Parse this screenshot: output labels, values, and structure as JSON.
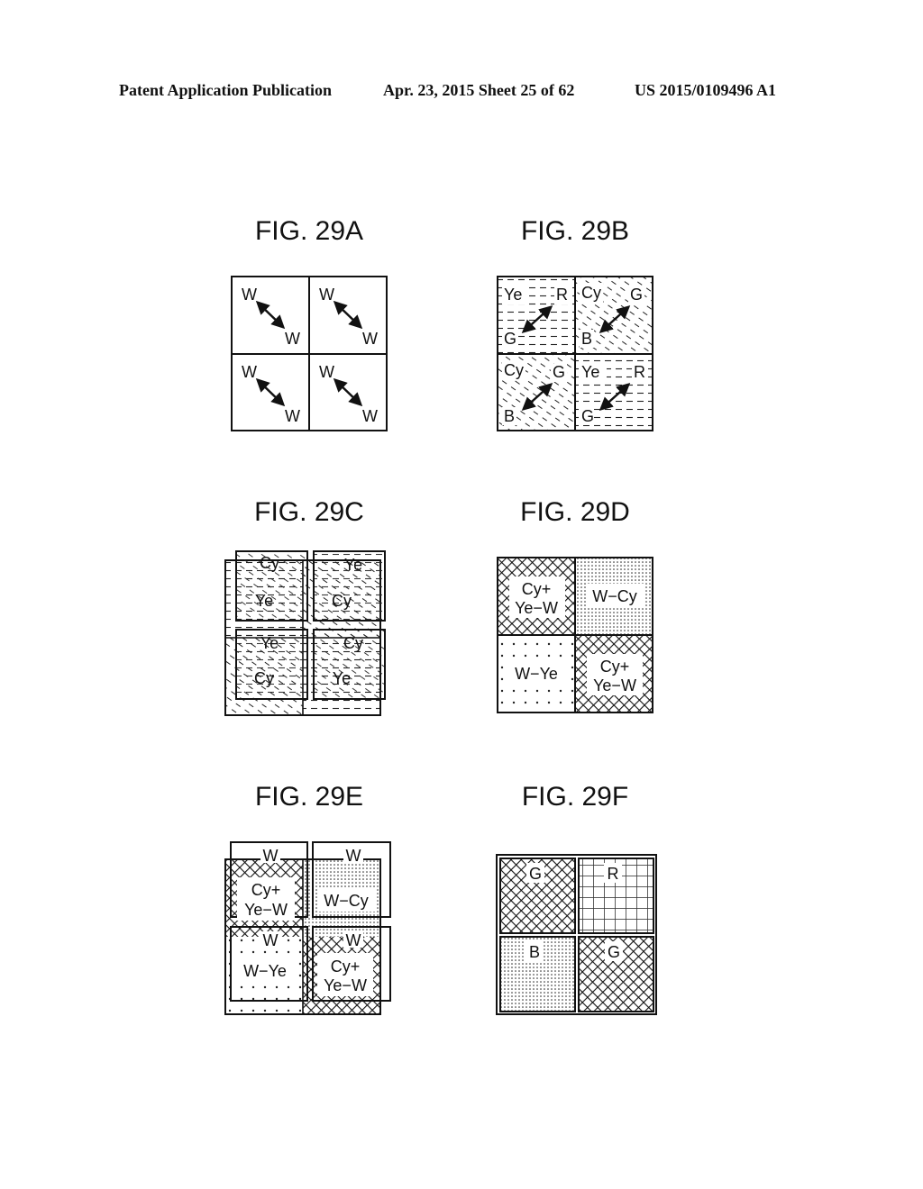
{
  "header": {
    "publication": "Patent Application Publication",
    "date_sheet": "Apr. 23, 2015  Sheet 25 of 62",
    "number": "US 2015/0109496 A1"
  },
  "figures": {
    "fig29a": {
      "title": "FIG. 29A",
      "cells": [
        {
          "top_left": "W",
          "bottom_right": "W"
        },
        {
          "top_left": "W",
          "bottom_right": "W"
        },
        {
          "top_left": "W",
          "bottom_right": "W"
        },
        {
          "top_left": "W",
          "bottom_right": "W"
        }
      ]
    },
    "fig29b": {
      "title": "FIG. 29B",
      "cells": [
        {
          "tl": "Ye",
          "tr": "R",
          "bl": "G",
          "pattern": "dashed-horizontal"
        },
        {
          "tl": "Cy",
          "tr": "G",
          "bl": "B",
          "pattern": "diagonal-dashed"
        },
        {
          "tl": "Cy",
          "tr": "G",
          "bl": "B",
          "pattern": "diagonal-dashed"
        },
        {
          "tl": "Ye",
          "tr": "R",
          "bl": "G",
          "pattern": "dashed-horizontal"
        }
      ]
    },
    "fig29c": {
      "title": "FIG. 29C",
      "cells": [
        {
          "top": "Cy",
          "center": "Ye"
        },
        {
          "top": "Ye",
          "center": "Cy"
        },
        {
          "top": "Ye",
          "center": "Cy"
        },
        {
          "top": "Cy",
          "center": "Ye"
        }
      ]
    },
    "fig29d": {
      "title": "FIG. 29D",
      "cells": [
        {
          "line1": "Cy+",
          "line2": "Ye−W",
          "pattern": "crosshatch"
        },
        {
          "line1": "W−Cy",
          "line2": "",
          "pattern": "fine-dots"
        },
        {
          "line1": "W−Ye",
          "line2": "",
          "pattern": "sparse-dots"
        },
        {
          "line1": "Cy+",
          "line2": "Ye−W",
          "pattern": "crosshatch"
        }
      ]
    },
    "fig29e": {
      "title": "FIG. 29E",
      "cells": [
        {
          "top": "W",
          "line1": "Cy+",
          "line2": "Ye−W"
        },
        {
          "top": "W",
          "line1": "W−Cy",
          "line2": ""
        },
        {
          "top": "W",
          "line1": "W−Ye",
          "line2": ""
        },
        {
          "top": "W",
          "line1": "Cy+",
          "line2": "Ye−W"
        }
      ]
    },
    "fig29f": {
      "title": "FIG. 29F",
      "cells": [
        {
          "label": "G",
          "pattern": "crosshatch"
        },
        {
          "label": "R",
          "pattern": "grid"
        },
        {
          "label": "B",
          "pattern": "fine-dots"
        },
        {
          "label": "G",
          "pattern": "crosshatch"
        }
      ]
    }
  }
}
